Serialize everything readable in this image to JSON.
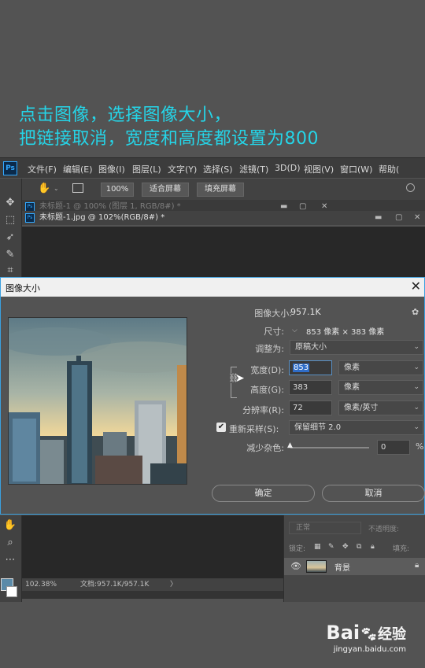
{
  "caption": {
    "line1": "点击图像，选择图像大小，",
    "line2": "把链接取消，宽度和高度都设置为800"
  },
  "menubar": {
    "logo": "Ps",
    "items": [
      "文件(F)",
      "编辑(E)",
      "图像(I)",
      "图层(L)",
      "文字(Y)",
      "选择(S)",
      "滤镜(T)",
      "3D(D)",
      "视图(V)",
      "窗口(W)",
      "帮助("
    ]
  },
  "options": {
    "zoom": "100%",
    "fit_screen": "适合屏幕",
    "fill_screen": "填充屏幕"
  },
  "tabs": [
    {
      "title": "未标题-1 @ 100% (图层 1, RGB/8#) *"
    },
    {
      "title": "未标题-1.jpg @ 102%(RGB/8#) *"
    }
  ],
  "dialog": {
    "title": "图像大小",
    "image_size_label": "图像大小:",
    "image_size_value": "957.1K",
    "dimensions_label": "尺寸:",
    "dimensions_value": "853 像素 × 383 像素",
    "fit_to_label": "调整为:",
    "fit_to_value": "原稿大小",
    "width_label": "宽度(D):",
    "width_value": "853",
    "width_unit": "像素",
    "height_label": "高度(G):",
    "height_value": "383",
    "height_unit": "像素",
    "resolution_label": "分辨率(R):",
    "resolution_value": "72",
    "resolution_unit": "像素/英寸",
    "resample_label": "重新采样(S):",
    "resample_value": "保留细节 2.0",
    "reduce_noise_label": "减少杂色:",
    "reduce_noise_value": "0",
    "reduce_noise_unit": "%",
    "ok": "确定",
    "cancel": "取消"
  },
  "status": {
    "zoom": "102.38%",
    "doc": "文档:957.1K/957.1K"
  },
  "layers": {
    "blend_mode": "正常",
    "opacity_label": "不透明度:",
    "lock_label": "锁定:",
    "fill_label": "填充:",
    "layer_name": "背景"
  },
  "watermark": {
    "brand": "Bai",
    "brand2": "经验",
    "url": "jingyan.baidu.com"
  }
}
